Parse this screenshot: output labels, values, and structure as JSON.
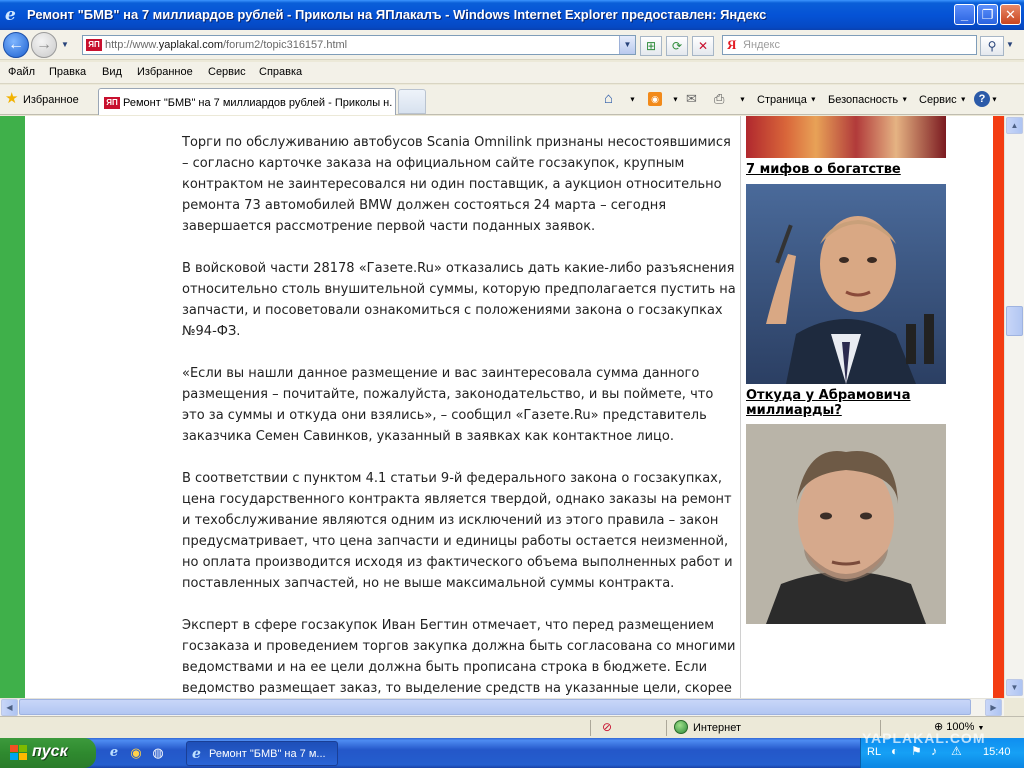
{
  "window": {
    "title": "Ремонт \"БМВ\" на 7 миллиардов рублей - Приколы на ЯПлакалъ - Windows Internet Explorer предоставлен: Яндекс",
    "minimize": "_",
    "maximize": "❐",
    "close": "✕"
  },
  "addressbar": {
    "url_prefix": "http://www.",
    "url_domain": "yaplakal.com",
    "url_path": "/forum2/topic316157.html",
    "site_badge": "ЯП",
    "search_logo": "Я",
    "search_placeholder": "Яндекс"
  },
  "menu": {
    "items": [
      "Файл",
      "Правка",
      "Вид",
      "Избранное",
      "Сервис",
      "Справка"
    ]
  },
  "favorites": {
    "label": "Избранное"
  },
  "tab": {
    "title": "Ремонт \"БМВ\" на 7 миллиардов рублей - Приколы н..."
  },
  "commandbar": {
    "page": "Страница",
    "safety": "Безопасность",
    "tools": "Сервис"
  },
  "article": {
    "paragraphs": [
      "Торги по обслуживанию автобусов Scania Omnilink признаны несостоявшимися – согласно карточке заказа на официальном сайте госзакупок, крупным контрактом не заинтересовался ни один поставщик, а аукцион относительно ремонта 73 автомобилей BMW должен состояться 24 марта – сегодня завершается рассмотрение первой части поданных заявок.",
      "В войсковой части 28178 «Газете.Ru» отказались дать какие-либо разъяснения относительно столь внушительной суммы, которую предполагается пустить на запчасти, и посоветовали ознакомиться с положениями закона о госзакупках №94-ФЗ.",
      "«Если вы нашли данное размещение и вас заинтересовала сумма данного размещения – почитайте, пожалуйста, законодательство, и вы поймете, что это за суммы и откуда они взялись», – сообщил «Газете.Ru» представитель заказчика Семен Савинков, указанный в заявках как контактное лицо.",
      "В соответствии с пунктом 4.1 статьи 9-й федерального закона о госзакупках, цена государственного контракта является твердой, однако заказы на ремонт и техобслуживание являются одним из исключений из этого правила – закон предусматривает, что цена запчасти и единицы работы остается неизменной, но оплата производится исходя из фактического объема выполненных работ и поставленных запчастей, но не выше максимальной суммы контракта.",
      "Эксперт в сфере госзакупок Иван Бегтин отмечает, что перед размещением госзаказа и проведением торгов закупка должна быть согласована со многими ведомствами и на ее цели должна быть прописана строка в бюджете. Если ведомство размещает заказ, то выделение средств на указанные цели, скорее"
    ]
  },
  "sidebar": {
    "link1": "7 мифов о богатстве",
    "link2": "Откуда у Абрамовича миллиарды?"
  },
  "statusbar": {
    "zone": "Интернет",
    "zoom": "100%"
  },
  "taskbar": {
    "start": "пуск",
    "task": "Ремонт \"БМВ\" на 7 м...",
    "lang": "RL",
    "clock": "15:40",
    "watermark": "YAPLAKAL.COM"
  }
}
